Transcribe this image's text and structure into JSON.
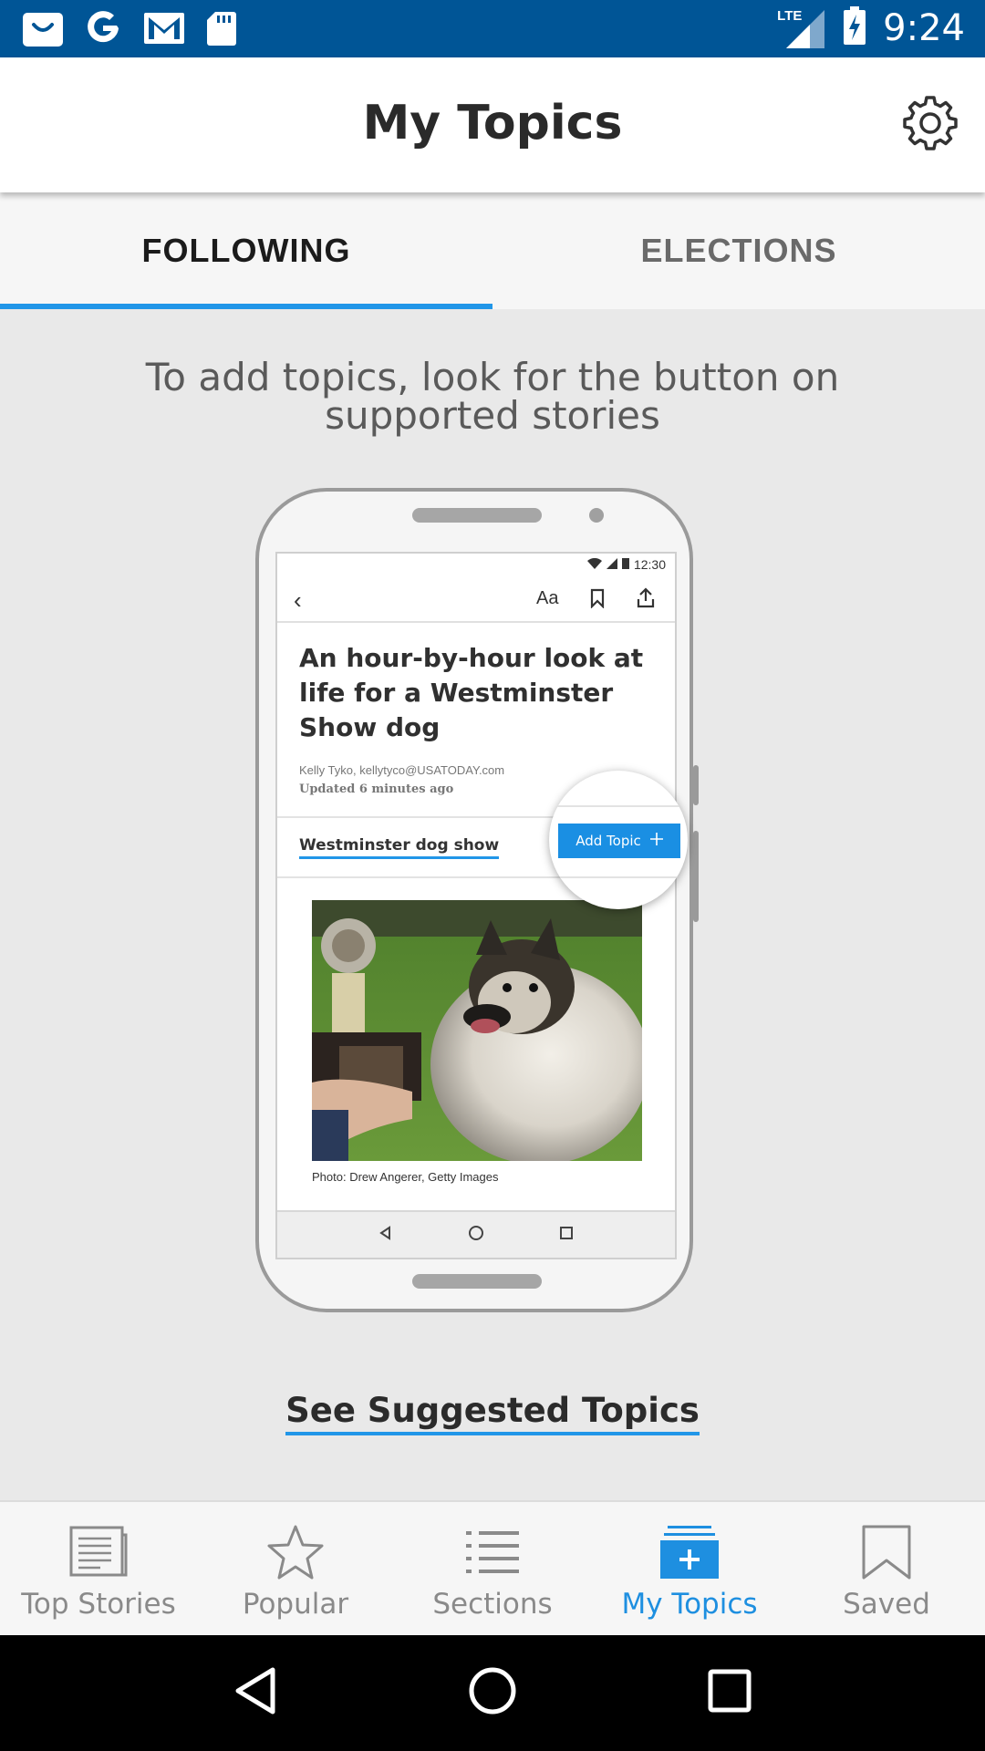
{
  "status_bar": {
    "time": "9:24",
    "network": "LTE",
    "notification_icons": [
      "shopping-bag-icon",
      "google-icon",
      "gmail-icon",
      "sd-card-icon"
    ]
  },
  "header": {
    "title": "My Topics",
    "settings_icon": "gear-icon"
  },
  "tabs": [
    {
      "label": "FOLLOWING",
      "active": true
    },
    {
      "label": "ELECTIONS",
      "active": false
    }
  ],
  "instruction": "To add topics, look for the button on supported stories",
  "illustration": {
    "status_time": "12:30",
    "toolbar_text_size": "Aa",
    "headline": "An hour-by-hour look at life for a Westminster Show dog",
    "byline": "Kelly Tyko, kellytyco@USATODAY.com",
    "updated": "Updated 6 minutes ago",
    "topic_link": "Westminster  dog show",
    "add_topic_button": "Add Topic",
    "photo_caption": "Photo: Drew Angerer, Getty Images"
  },
  "suggested_link": "See Suggested Topics",
  "bottom_nav": [
    {
      "label": "Top Stories",
      "icon": "newspaper-icon",
      "active": false
    },
    {
      "label": "Popular",
      "icon": "star-icon",
      "active": false
    },
    {
      "label": "Sections",
      "icon": "list-icon",
      "active": false
    },
    {
      "label": "My Topics",
      "icon": "my-topics-icon",
      "active": true
    },
    {
      "label": "Saved",
      "icon": "bookmark-icon",
      "active": false
    }
  ],
  "colors": {
    "status_bar": "#005596",
    "accent": "#2196e8",
    "active_nav": "#1e8fe0"
  }
}
